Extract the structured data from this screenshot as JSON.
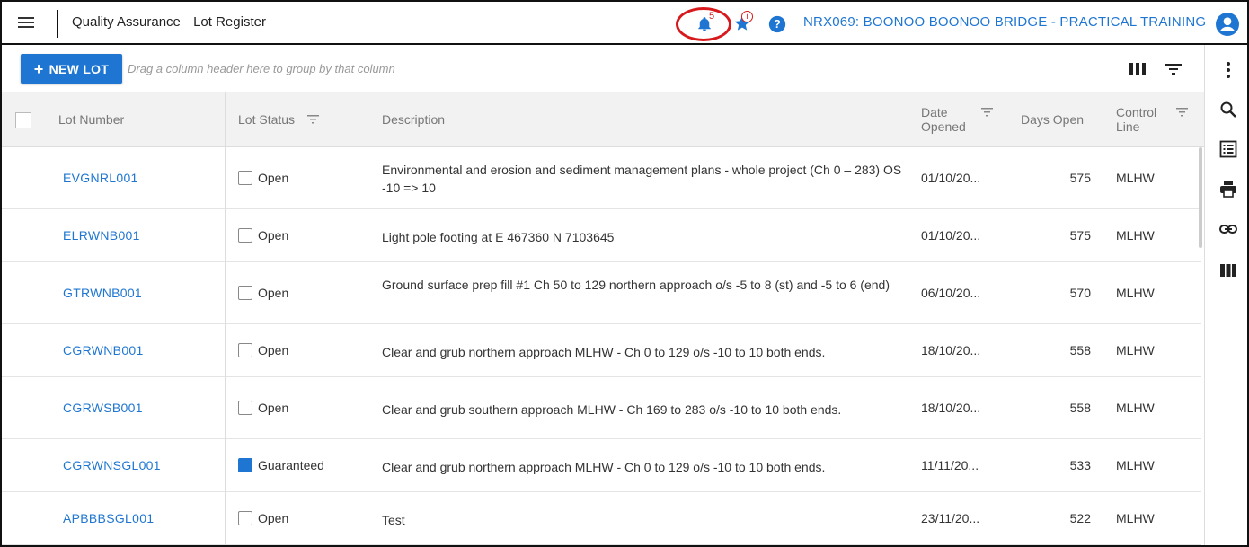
{
  "header": {
    "breadcrumb": [
      "Quality Assurance",
      "Lot Register"
    ],
    "notification_count": "5",
    "favourite_badge": "i",
    "project": "NRX069: BOONOO BOONOO BRIDGE - PRACTICAL TRAINING"
  },
  "toolbar": {
    "new_lot_label": "NEW LOT",
    "new_lot_icon": "+",
    "group_hint": "Drag a column header here to group by that column"
  },
  "grid": {
    "columns": {
      "lot_number": "Lot Number",
      "lot_status": "Lot Status",
      "description": "Description",
      "date_opened": "Date Opened",
      "days_open": "Days Open",
      "control_line": "Control Line"
    },
    "rows": [
      {
        "lot": "EVGNRL001",
        "status": "Open",
        "checked": false,
        "description": "Environmental and erosion and sediment management plans - whole project (Ch 0 – 283) OS -10 => 10",
        "date": "01/10/20...",
        "days": "575",
        "control_line": "MLHW"
      },
      {
        "lot": "ELRWNB001",
        "status": "Open",
        "checked": false,
        "description": "Light pole footing at E 467360 N 7103645",
        "date": "01/10/20...",
        "days": "575",
        "control_line": "MLHW"
      },
      {
        "lot": "GTRWNB001",
        "status": "Open",
        "checked": false,
        "description": "Ground surface prep fill #1 Ch 50 to 129 northern approach o/s -5 to 8 (st) and -5 to 6 (end)",
        "date": "06/10/20...",
        "days": "570",
        "control_line": "MLHW"
      },
      {
        "lot": "CGRWNB001",
        "status": "Open",
        "checked": false,
        "description": "Clear and grub northern approach MLHW - Ch 0 to 129 o/s -10 to 10 both ends.",
        "date": "18/10/20...",
        "days": "558",
        "control_line": "MLHW"
      },
      {
        "lot": "CGRWSB001",
        "status": "Open",
        "checked": false,
        "description": "Clear and grub southern approach MLHW - Ch 169 to 283 o/s -10 to 10 both ends.",
        "date": "18/10/20...",
        "days": "558",
        "control_line": "MLHW"
      },
      {
        "lot": "CGRWNSGL001",
        "status": "Guaranteed",
        "checked": true,
        "description": "Clear and grub northern approach MLHW - Ch 0 to 129 o/s -10 to 10 both ends.",
        "date": "11/11/20...",
        "days": "533",
        "control_line": "MLHW"
      },
      {
        "lot": "APBBBSGL001",
        "status": "Open",
        "checked": false,
        "description": "Test",
        "date": "23/11/20...",
        "days": "522",
        "control_line": "MLHW"
      }
    ]
  },
  "rail": {
    "icons": [
      "more-vert-icon",
      "search-icon",
      "list-icon",
      "print-icon",
      "link-icon",
      "columns-icon"
    ]
  },
  "colors": {
    "accent": "#1e76d2",
    "alert": "#d7191c"
  }
}
